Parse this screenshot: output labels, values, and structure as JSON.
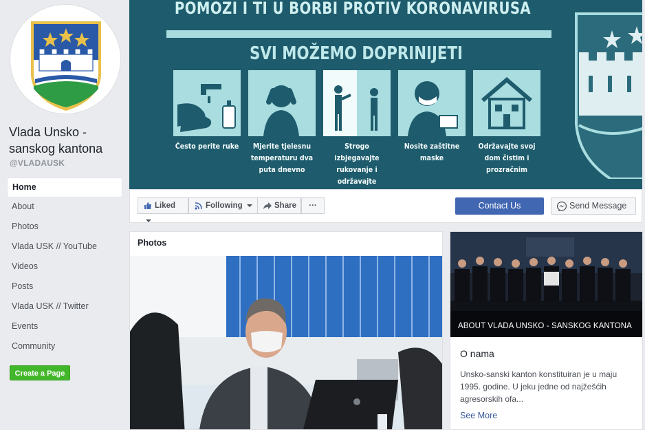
{
  "page": {
    "name": "Vlada Unsko - sanskog kantona",
    "handle": "@VLADAUSK"
  },
  "nav": {
    "items": [
      {
        "label": "Home",
        "active": true
      },
      {
        "label": "About"
      },
      {
        "label": "Photos"
      },
      {
        "label": "Vlada USK // YouTube"
      },
      {
        "label": "Videos"
      },
      {
        "label": "Posts"
      },
      {
        "label": "Vlada USK // Twitter"
      },
      {
        "label": "Events"
      },
      {
        "label": "Community"
      }
    ],
    "create_page": "Create a Page"
  },
  "cover": {
    "title": "POMOZI I TI U BORBI PROTIV KORONAVIRUSA",
    "subtitle": "SVI MOŽEMO DOPRINIJETI",
    "tips": [
      "Često perite ruke",
      "Mjerite tjelesnu temperaturu dva puta dnevno",
      "Strogo izbjegavajte rukovanje i održavajte socijalnu distancu",
      "Nosite zaštitne maske",
      "Održavajte svoj dom čistim i prozračnim"
    ]
  },
  "actions": {
    "liked": "Liked",
    "following": "Following",
    "share": "Share",
    "more": "···",
    "contact": "Contact Us",
    "send_message": "Send Message"
  },
  "photos": {
    "title": "Photos"
  },
  "about": {
    "image_label": "ABOUT VLADA UNSKO - SANSKOG KANTONA",
    "heading": "O nama",
    "text": "Unsko-sanski kanton konstituiran je u maju 1995. godine. U jeku jedne od najžešćih agresorskih ofa...",
    "see_more": "See More"
  },
  "colors": {
    "cover_bg": "#1e5b6c",
    "tile_bg": "#a9dde0",
    "fb_blue": "#4267b2",
    "create_green": "#42b72a"
  }
}
